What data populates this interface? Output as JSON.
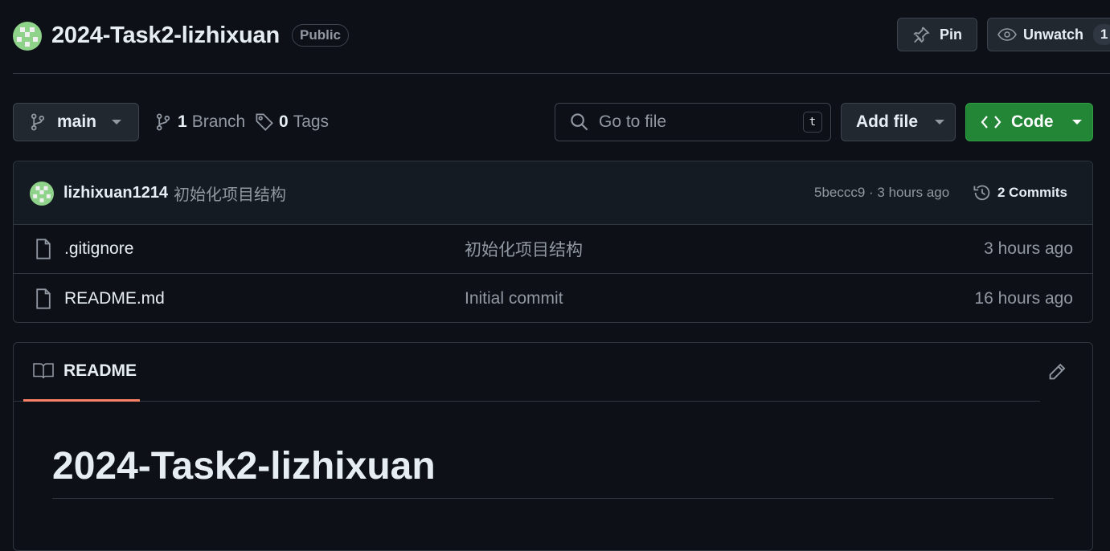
{
  "repo": {
    "name": "2024-Task2-lizhixuan",
    "visibility": "Public"
  },
  "actions": {
    "pin_label": "Pin",
    "unwatch_label": "Unwatch",
    "watch_count": "1"
  },
  "toolbar": {
    "branch": "main",
    "branch_count": "1",
    "branch_label": "Branch",
    "tag_count": "0",
    "tag_label": "Tags",
    "search_placeholder": "Go to file",
    "search_shortcut": "t",
    "add_file_label": "Add file",
    "code_label": "Code"
  },
  "latest_commit": {
    "author": "lizhixuan1214",
    "message": "初始化项目结构",
    "meta": "5beccc9 · 3 hours ago",
    "commits_label": "2 Commits"
  },
  "files": [
    {
      "name": ".gitignore",
      "message": "初始化项目结构",
      "time": "3 hours ago"
    },
    {
      "name": "README.md",
      "message": "Initial commit",
      "time": "16 hours ago"
    }
  ],
  "readme": {
    "tab_label": "README",
    "heading": "2024-Task2-lizhixuan"
  },
  "colors": {
    "background": "#0d1117",
    "code_button": "#238636",
    "readme_tab_underline": "#f78166",
    "avatar_green": "#8fd28a"
  }
}
